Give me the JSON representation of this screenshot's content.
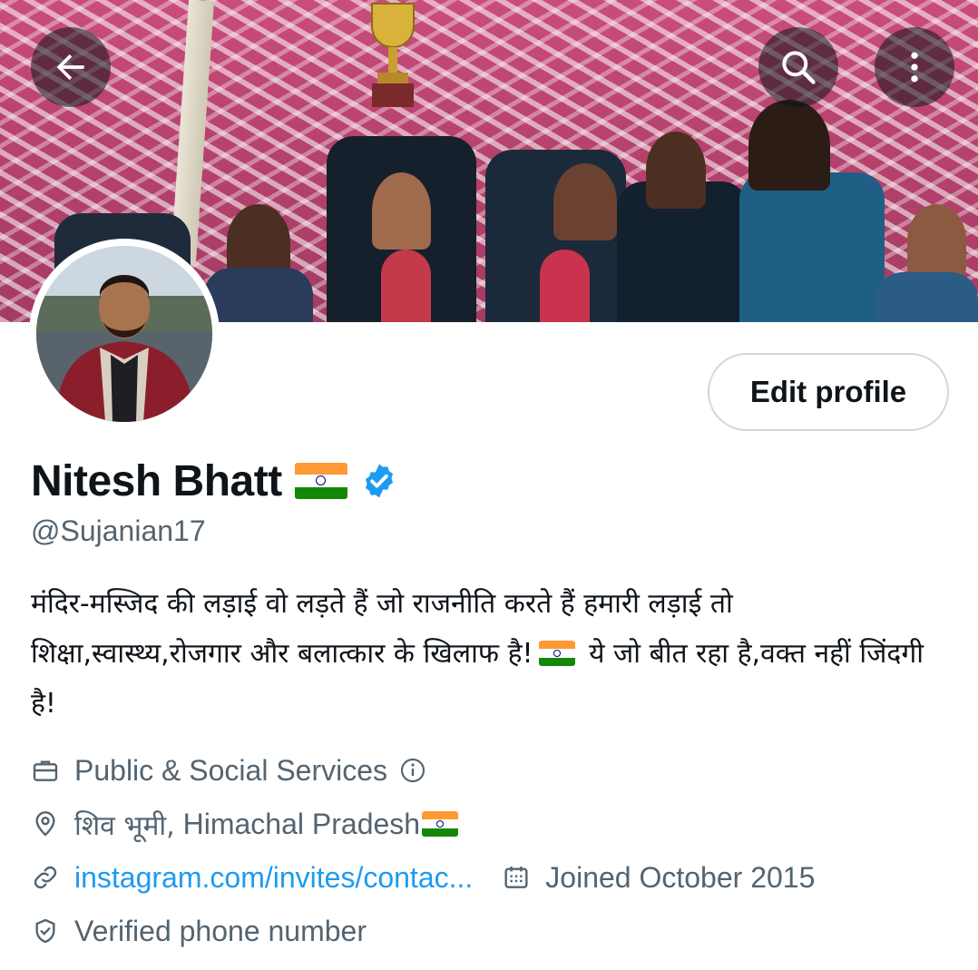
{
  "header": {
    "back_icon": "arrow-left-icon",
    "search_icon": "search-icon",
    "more_icon": "more-vertical-icon"
  },
  "profile": {
    "name": "Nitesh Bhatt",
    "handle": "@Sujanian17",
    "edit_label": "Edit profile",
    "verified": true,
    "badge_color": "#1d9bf0",
    "bio_text_1": "मंदिर-मस्जिद की लड़ाई वो लड़ते हैं जो राजनीति करते हैं हमारी लड़ाई तो शिक्षा,स्वास्थ्य,रोजगार और बलात्कार के खिलाफ है!",
    "bio_text_2": " ये जो बीत रहा है,वक्त नहीं जिंदगी है!",
    "category": "Public & Social Services",
    "location_hi": "शिव भूमी,",
    "location_en": " Himachal Pradesh",
    "website": "instagram.com/invites/contac...",
    "joined": "Joined October 2015",
    "verified_phone": "Verified phone number"
  },
  "colors": {
    "text": "#0f1419",
    "muted": "#536471",
    "link": "#1d9bf0",
    "border": "#cfd9de"
  }
}
